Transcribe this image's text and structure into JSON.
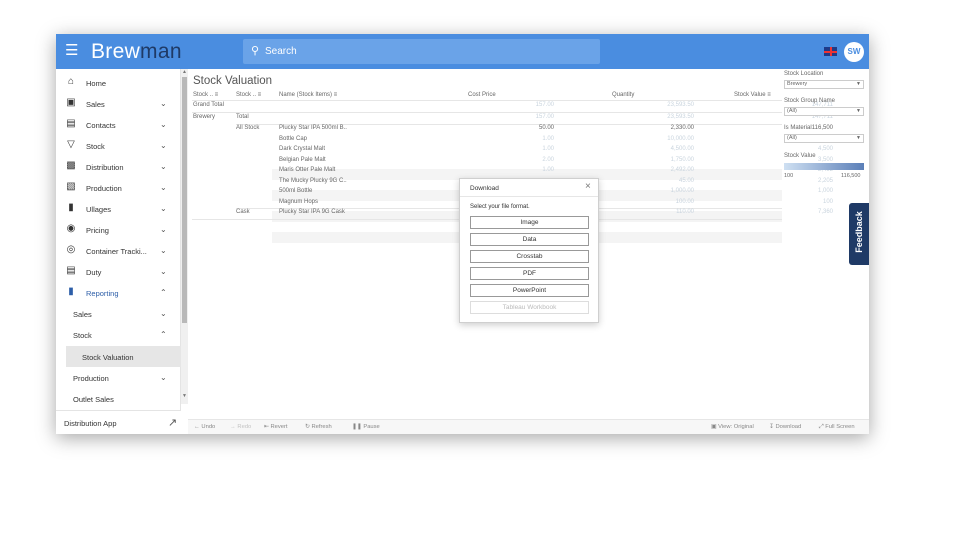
{
  "app": {
    "logo_main": "Brew",
    "logo_accent": "man",
    "search_placeholder": "Search",
    "user_initials": "SW"
  },
  "sidebar": {
    "items": [
      {
        "label": "Home",
        "icon": "home-icon"
      },
      {
        "label": "Sales",
        "icon": "basket-icon",
        "chevron": "down"
      },
      {
        "label": "Contacts",
        "icon": "contacts-icon",
        "chevron": "down"
      },
      {
        "label": "Stock",
        "icon": "funnel-icon",
        "chevron": "down"
      },
      {
        "label": "Distribution",
        "icon": "truck-icon",
        "chevron": "down"
      },
      {
        "label": "Production",
        "icon": "factory-icon",
        "chevron": "down"
      },
      {
        "label": "Ullages",
        "icon": "bin-icon",
        "chevron": "down"
      },
      {
        "label": "Pricing",
        "icon": "dollar-icon",
        "chevron": "down"
      },
      {
        "label": "Container Tracki...",
        "icon": "target-icon",
        "chevron": "down"
      },
      {
        "label": "Duty",
        "icon": "document-icon",
        "chevron": "down"
      },
      {
        "label": "Reporting",
        "icon": "report-icon",
        "chevron": "up"
      }
    ],
    "reporting_sub": [
      {
        "label": "Sales",
        "chevron": "down"
      },
      {
        "label": "Stock",
        "chevron": "up"
      },
      {
        "label": "Stock Valuation"
      },
      {
        "label": "Production",
        "chevron": "down"
      },
      {
        "label": "Outlet Sales"
      }
    ],
    "distribution_app": "Distribution App"
  },
  "view": {
    "title": "Stock Valuation",
    "columns": {
      "stock1": "Stock ..",
      "stock2": "Stock ..",
      "name": "Name (Stock Items)",
      "cost": "Cost Price",
      "qty": "Quantity",
      "value": "Stock Value"
    },
    "rows": [
      {
        "c1": "Grand Total",
        "c2": "",
        "c3": "",
        "cost": "157.00",
        "qty": "23,593.50",
        "value": "147,711",
        "faded": true
      },
      {
        "c1": "Brewery",
        "c2": "Total",
        "c3": "",
        "cost": "157.00",
        "qty": "23,593.50",
        "value": "147,711",
        "faded": true
      },
      {
        "c1": "",
        "c2": "All Stock",
        "c3": "Plucky Star IPA 500ml B..",
        "cost": "50.00",
        "qty": "2,330.00",
        "value": "116,500",
        "faded": false
      },
      {
        "c1": "",
        "c2": "",
        "c3": "Bottle Cap",
        "cost": "1.00",
        "qty": "10,000.00",
        "value": "10,000",
        "faded": true
      },
      {
        "c1": "",
        "c2": "",
        "c3": "Dark Crystal Malt",
        "cost": "1.00",
        "qty": "4,500.00",
        "value": "4,500",
        "faded": true
      },
      {
        "c1": "",
        "c2": "",
        "c3": "Belgian Pale Malt",
        "cost": "2.00",
        "qty": "1,750.00",
        "value": "3,500",
        "faded": true
      },
      {
        "c1": "",
        "c2": "",
        "c3": "Maris Otter Pale Malt",
        "cost": "1.00",
        "qty": "2,492.00",
        "value": "2,492",
        "faded": true
      },
      {
        "c1": "",
        "c2": "",
        "c3": "The Mucky Plucky 9G C..",
        "cost": "",
        "qty": "45.00",
        "value": "2,205",
        "faded": true
      },
      {
        "c1": "",
        "c2": "",
        "c3": "500ml Bottle",
        "cost": "",
        "qty": "1,000.00",
        "value": "1,000",
        "faded": true
      },
      {
        "c1": "",
        "c2": "",
        "c3": "Magnum Hops",
        "cost": "",
        "qty": "100.00",
        "value": "100",
        "faded": true
      },
      {
        "c1": "",
        "c2": "Cask",
        "c3": "Plucky Star IPA 9G Cask",
        "cost": "",
        "qty": "110.00",
        "value": "7,360",
        "faded": true
      }
    ]
  },
  "filters": {
    "stock_location_label": "Stock Location",
    "stock_location_value": "Brewery",
    "stock_group_label": "Stock Group Name",
    "stock_group_value": "(All)",
    "is_material_label": "Is Material",
    "is_material_value": "(All)",
    "stock_value_label": "Stock Value",
    "stock_value_min": "100",
    "stock_value_max": "116,500"
  },
  "feedback_label": "Feedback",
  "download_dialog": {
    "title": "Download",
    "prompt": "Select your file format.",
    "options": [
      "Image",
      "Data",
      "Crosstab",
      "PDF",
      "PowerPoint",
      "Tableau Workbook"
    ]
  },
  "toolbar": {
    "undo": "Undo",
    "redo": "Redo",
    "revert": "Revert",
    "refresh": "Refresh",
    "pause": "Pause",
    "view_original": "View: Original",
    "download": "Download",
    "full_screen": "Full Screen"
  },
  "colors": {
    "topbar": "#4a8de0",
    "accent_dark": "#1f3a66"
  }
}
